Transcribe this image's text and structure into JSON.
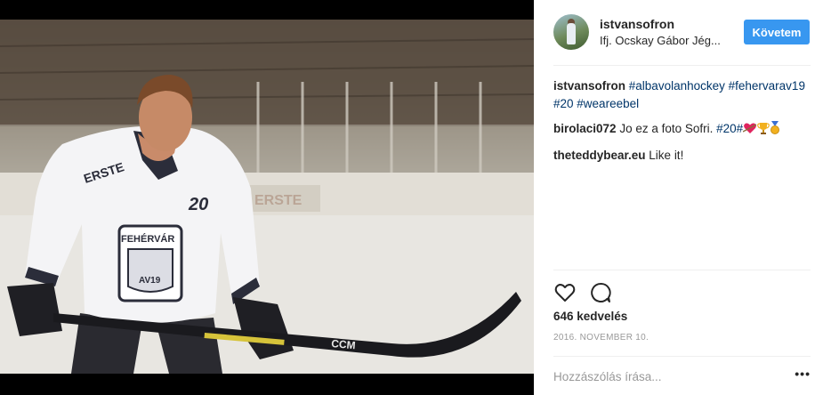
{
  "post": {
    "author": "istvansofron",
    "location": "Ifj. Ocskay Gábor Jég...",
    "follow_label": "Követem",
    "caption_author": "istvansofron",
    "caption_tags": [
      "#albavolanhockey",
      "#fehervarav19",
      "#20",
      "#weareebel"
    ],
    "comments": [
      {
        "user": "birolaci072",
        "text": "Jo ez a foto Sofri.",
        "tag": "#20#",
        "emojis": [
          "heart-arrow-icon",
          "trophy-icon",
          "medal-icon"
        ]
      },
      {
        "user": "theteddybear.eu",
        "text": "Like it!"
      }
    ],
    "likes": "646 kedvelés",
    "date": "2016. NOVEMBER 10.",
    "comment_placeholder": "Hozzászólás írása...",
    "more_label": "•••",
    "jersey_number": "20",
    "jersey_text": "FEHÉRVÁR",
    "jersey_sub": "AV19",
    "sponsor": "ERSTE",
    "stick_brand": "CCM"
  },
  "colors": {
    "accent": "#3897f0",
    "hashtag": "#003569",
    "muted": "#999999",
    "divider": "#efefef"
  }
}
